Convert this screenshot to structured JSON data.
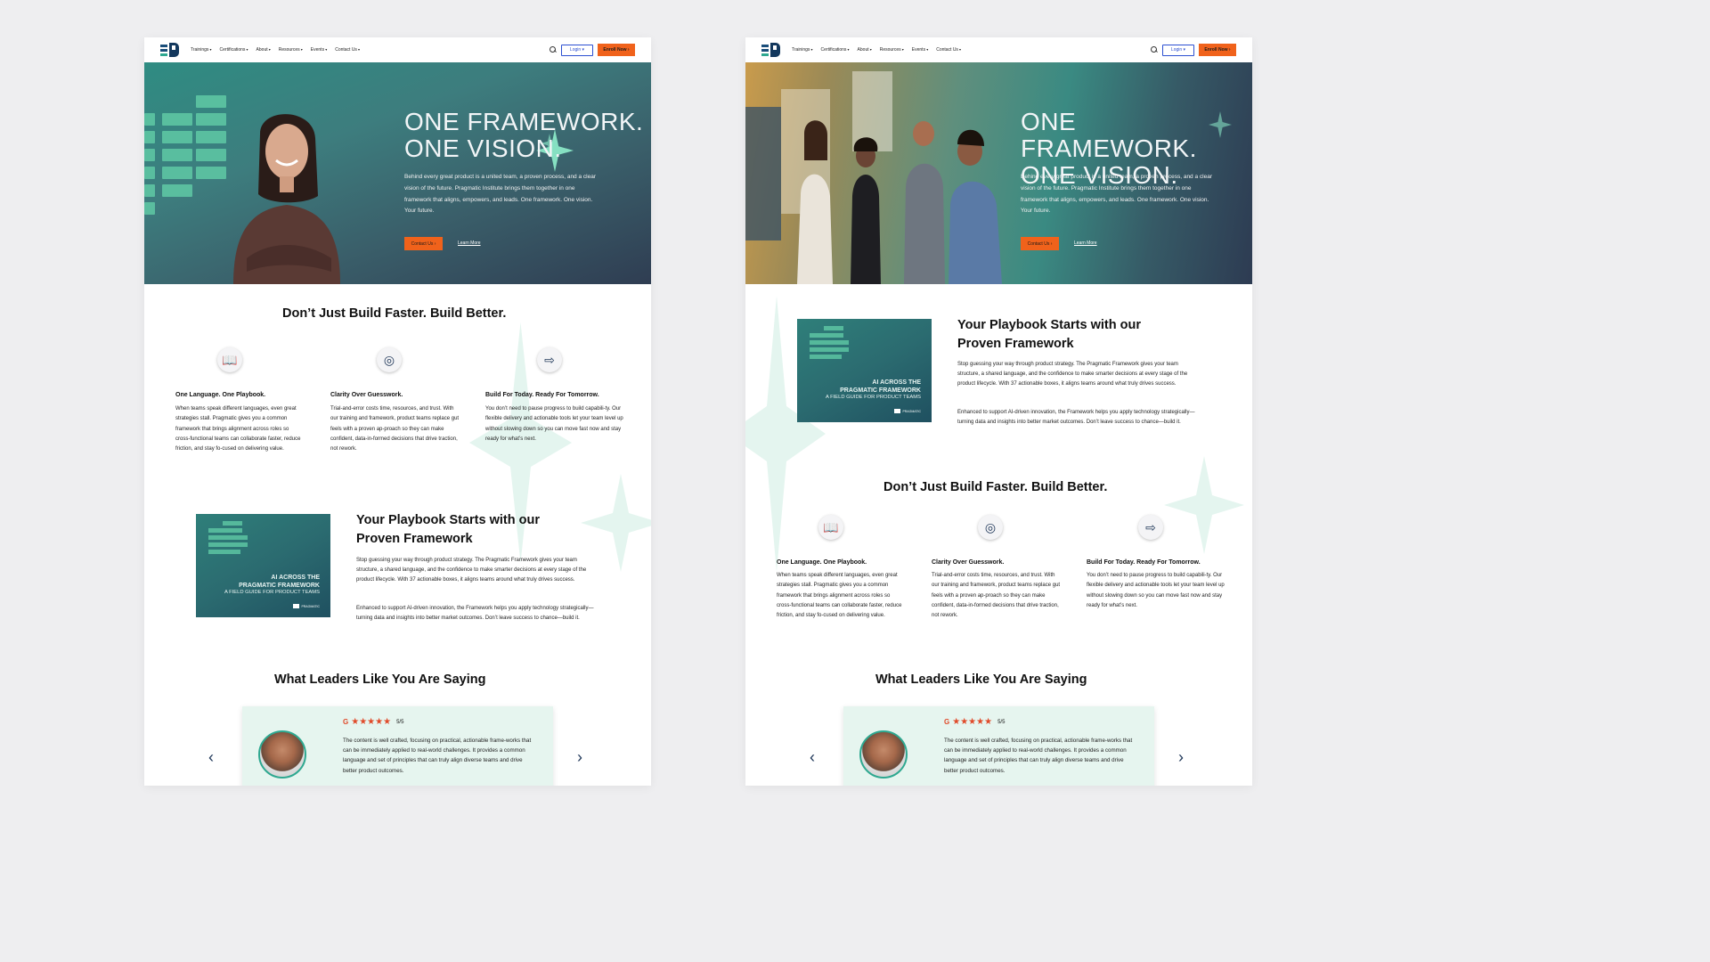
{
  "nav": {
    "links": [
      "Trainings",
      "Certifications",
      "About",
      "Resources",
      "Events",
      "Contact Us"
    ],
    "login": "Login",
    "enroll": "Enroll Now"
  },
  "hero": {
    "title_line1": "ONE FRAMEWORK.",
    "title_line2": "ONE VISION.",
    "text": "Behind every great product is a united team, a proven process, and a clear vision of the future. Pragmatic Institute brings them together in one framework that aligns, empowers, and leads. One framework. One vision. Your future.",
    "cta": "Contact Us",
    "learn": "Learn More"
  },
  "features": {
    "heading": "Don’t Just Build Faster. Build Better.",
    "items": [
      {
        "icon": "book-icon",
        "title": "One Language. One Playbook.",
        "text": "When teams speak different languages, even great strategies stall. Pragmatic gives you a common framework that brings alignment across roles so cross-functional teams can collaborate faster, reduce friction, and stay fo-cused on delivering value."
      },
      {
        "icon": "target-icon",
        "title": "Clarity Over Guesswork.",
        "text": "Trial-and-error costs time, resources, and trust. With our training and framework, product teams replace gut feels with a proven ap-proach so they can make confident, data-in-formed decisions that drive traction, not rework."
      },
      {
        "icon": "export-icon",
        "title": "Build For Today. Ready For Tomorrow.",
        "text": "You don’t need to pause progress to build capabili-ty. Our flexible delivery and actionable tools let your team level up without slowing down so you can move fast now and stay ready for what’s next."
      }
    ]
  },
  "playbook": {
    "title_line1": "Your Playbook Starts with our",
    "title_line2": "Proven Framework",
    "para1": "Stop guessing your way through product strategy. The Pragmatic Framework gives your team structure, a shared language, and the confidence to make smarter decisions at every stage of the product lifecycle. With 37 actionable boxes, it aligns teams around what truly drives success.",
    "para2": "Enhanced to support AI-driven innovation, the Framework helps you apply technology strategically—turning data and insights into better market outcomes. Don’t leave success to chance—build it.",
    "cover_line1": "AI ACROSS THE",
    "cover_line2": "PRAGMATIC FRAMEWORK",
    "cover_sub": "A FIELD GUIDE FOR PRODUCT TEAMS",
    "cover_logo": "PRAGMATIC"
  },
  "testimonials": {
    "heading": "What Leaders Like You Are Saying",
    "source": "G",
    "stars": "★★★★★",
    "score": "5/5",
    "quote": "The content is well crafted, focusing on practical, actionable frame-works that can be immediately applied to real-world challenges. It provides a common language and set of principles that can truly align diverse teams and drive better product outcomes.",
    "prev": "‹",
    "next": "›"
  },
  "colors": {
    "accent_orange": "#f0621b",
    "teal": "#2ea890",
    "navy": "#13385d",
    "mint": "#e6f5ef"
  }
}
